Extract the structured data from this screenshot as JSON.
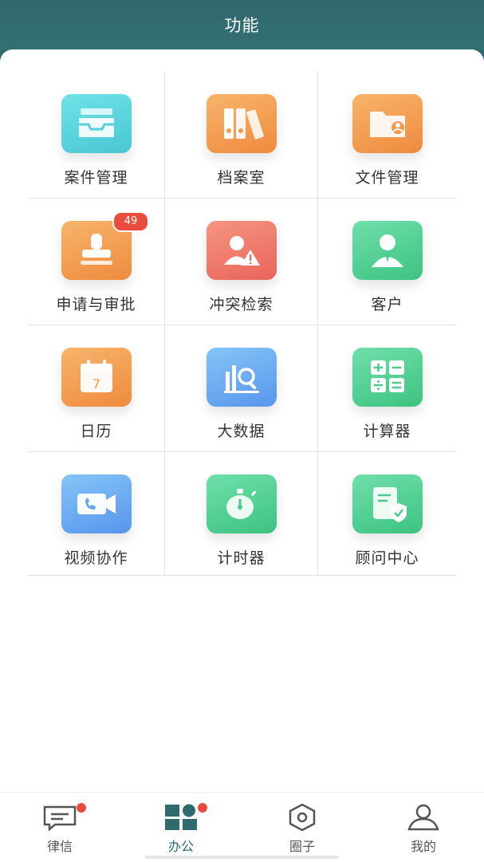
{
  "header": {
    "title": "功能"
  },
  "grid": {
    "items": [
      {
        "label": "案件管理",
        "icon": "inbox-tray-icon",
        "color": "#55cfdc"
      },
      {
        "label": "档案室",
        "icon": "binders-icon",
        "color": "#f2994a"
      },
      {
        "label": "文件管理",
        "icon": "folder-user-icon",
        "color": "#f2994a"
      },
      {
        "label": "申请与审批",
        "icon": "stamp-icon",
        "color": "#f2994a",
        "badge": "49"
      },
      {
        "label": "冲突检索",
        "icon": "user-warning-icon",
        "color": "#ec7263"
      },
      {
        "label": "客户",
        "icon": "client-icon",
        "color": "#4acb8d"
      },
      {
        "label": "日历",
        "icon": "calendar-icon",
        "color": "#f2994a",
        "day": "7"
      },
      {
        "label": "大数据",
        "icon": "chart-search-icon",
        "color": "#64a5ef"
      },
      {
        "label": "计算器",
        "icon": "calculator-icon",
        "color": "#4acb8d"
      },
      {
        "label": "视频协作",
        "icon": "video-call-icon",
        "color": "#64a5ef"
      },
      {
        "label": "计时器",
        "icon": "stopwatch-icon",
        "color": "#4acb8d"
      },
      {
        "label": "顾问中心",
        "icon": "shield-document-icon",
        "color": "#4acb8d"
      }
    ]
  },
  "tabbar": {
    "tabs": [
      {
        "label": "律信",
        "icon": "chat-icon",
        "dot": true
      },
      {
        "label": "办公",
        "icon": "office-grid-icon",
        "dot": true,
        "active": true
      },
      {
        "label": "圈子",
        "icon": "hexagon-icon"
      },
      {
        "label": "我的",
        "icon": "profile-icon"
      }
    ]
  },
  "colors": {
    "header": "#2f6b6e",
    "badge": "#e74c3c",
    "active_tab": "#2f6b6e"
  }
}
